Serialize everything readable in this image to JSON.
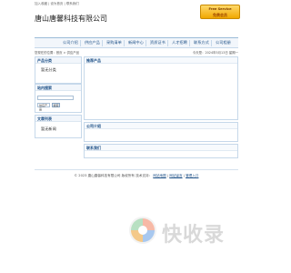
{
  "topbar": {
    "links": [
      "加入收藏",
      "设为首页",
      "联系我们"
    ]
  },
  "badge": {
    "line1": "Free Service",
    "line2": "免费会员"
  },
  "header": {
    "company_name": "唐山唐馨科技有限公司"
  },
  "nav": {
    "items": [
      "公司介绍",
      "供应产品",
      "采购清单",
      "新闻中心",
      "资质证书",
      "人才招聘",
      "联系方式",
      "公司相册"
    ]
  },
  "breadcrumb": {
    "left": "您现在的位置：首页 > 供应产品",
    "right": "今天是：2024年5月13日  星期一"
  },
  "sidebar": {
    "category_title": "产品分类",
    "category_empty": "暂无分类",
    "search_title": "站内搜索",
    "search_placeholder": "",
    "search_select": "供应产品",
    "search_button": "搜索",
    "news_title": "文章列表",
    "news_empty": "暂无新闻"
  },
  "main": {
    "products_title": "推荐产品",
    "intro_title": "公司介绍",
    "contact_title": "联系我们"
  },
  "footer": {
    "copyright": "© 2023 唐山唐馨科技有限公司 版权所有",
    "tech_label": "技术支持：",
    "links": [
      "网站地图",
      "网站留言",
      "管理入口"
    ]
  },
  "watermark": {
    "text": "快收录"
  },
  "colors": {
    "nav_text": "#1c4f86",
    "border": "#c6d8ea",
    "badge": "#f0a800"
  }
}
